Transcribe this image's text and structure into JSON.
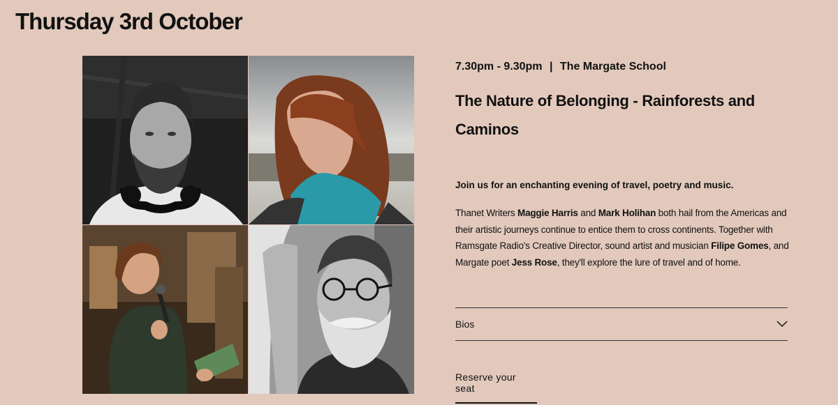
{
  "header": {
    "date": "Thursday 3rd October"
  },
  "event": {
    "time": "7.30pm - 9.30pm",
    "separator": "|",
    "venue": "The Margate School",
    "title": "The Nature of Belonging - Rainforests and Caminos",
    "lead": "Join us for an enchanting evening of travel, poetry and music.",
    "description": {
      "t1": "Thanet Writers ",
      "p1": "Maggie Harris",
      "t2": " and ",
      "p2": "Mark Holihan",
      "t3": " both hail from the Americas and their artistic journeys continue to entice them to cross continents. Together with Ramsgate Radio's Creative Director, sound artist and musician ",
      "p3": "Filipe Gomes",
      "t4": ", and Margate poet ",
      "p4": "Jess Rose",
      "t5": ", they'll explore the lure of travel and of home."
    }
  },
  "accordion": {
    "bios_label": "Bios",
    "icon": "chevron-down-icon"
  },
  "cta": {
    "reserve_label": "Reserve your seat"
  },
  "photos": [
    {
      "name": "photo-man-headphones"
    },
    {
      "name": "photo-woman-red-hair"
    },
    {
      "name": "photo-woman-microphone"
    },
    {
      "name": "photo-man-glasses"
    }
  ],
  "colors": {
    "background": "#e2c9bc",
    "text": "#111111"
  }
}
